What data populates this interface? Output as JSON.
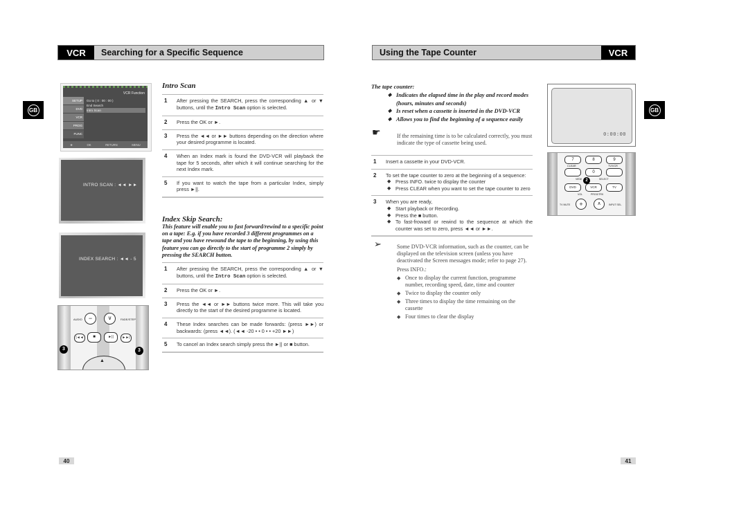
{
  "left_page": {
    "section_tag": "VCR",
    "title": "Searching for a Specific Sequence",
    "language_badge": "GB",
    "page_number": "40",
    "menu_screen": {
      "header": "VCR Function",
      "tabs": [
        "SETUP",
        "DVD",
        "VCR",
        "PROG",
        "FUNC"
      ],
      "items": [
        "Go to ( 0 : 00 : 00 )",
        "End Search",
        "Intro Scan"
      ],
      "selected_item": "Intro Scan",
      "footer": [
        "OK",
        "RETURN",
        "MENU"
      ]
    },
    "intro_screen_text": "INTRO SCAN  :   ◄◄   ►►",
    "index_screen_text": "INDEX SEARCH :  ◄◄  - 5",
    "remote": {
      "labels": [
        "AUDIO",
        "FADE/STEP"
      ],
      "callout": "3"
    },
    "intro_scan": {
      "heading": "Intro Scan",
      "steps": [
        {
          "n": "1",
          "pre": "After pressing the SEARCH, press the corresponding ▲ or ▼ buttons, until the ",
          "code": "Intro Scan",
          "post": " option is selected."
        },
        {
          "n": "2",
          "text": "Press the OK or ►."
        },
        {
          "n": "3",
          "text": "Press the ◄◄ or ►► buttons depending on the direction where your desired programme is located."
        },
        {
          "n": "4",
          "text": "When an Index mark is found the DVD-VCR will playback the tape for 5 seconds, after which it will continue searching for the next Index mark."
        },
        {
          "n": "5",
          "text": "If you want to watch the tape from a particular Index, simply press ►||."
        }
      ]
    },
    "index_skip": {
      "heading": "Index Skip Search:",
      "intro": "This feature will enable you to fast forward/rewind to a specific point on a tape: E.g. if you have recorded 3 different programmes on a tape and you have rewound the tape to the beginning, by using this feature you can go directly to the start of programme 2 simply by pressing the SEARCH button.",
      "steps": [
        {
          "n": "1",
          "pre": "After pressing the SEARCH, press the corresponding ▲ or ▼ buttons, until the ",
          "code": "Intro Scan",
          "post": " option is selected."
        },
        {
          "n": "2",
          "text": "Press the OK or ►."
        },
        {
          "n": "3",
          "text": "Press the ◄◄ or ►► buttons twice more. This will take you directly to the start of the desired programme is located."
        },
        {
          "n": "4",
          "text": "These Index searches can be made forwards: (press ►►) or backwards: (press ◄◄). (◄◄ -20 • • 0 • • +20 ►►)"
        },
        {
          "n": "5",
          "text": "To cancel an Index search simply press the ►|| or ■ button."
        }
      ]
    }
  },
  "right_page": {
    "section_tag": "VCR",
    "title": "Using the Tape Counter",
    "language_badge": "GB",
    "page_number": "41",
    "counter_screen_value": "0:00:00",
    "intro_heading": "The tape counter:",
    "intro_bullets": [
      "Indicates the elapsed time in the play and record modes (hours, minutes and seconds)",
      "Is reset when a cassette is inserted in the DVD-VCR",
      "Allows you to find the beginning of a sequence easily"
    ],
    "hand_note": "If the remaining time is to be calculated correctly, you must indicate the type of cassette being used.",
    "steps": [
      {
        "n": "1",
        "text": "Insert a cassette in your DVD-VCR.",
        "bullets": []
      },
      {
        "n": "2",
        "text": "To set the tape counter to zero at the beginning of a sequence:",
        "bullets": [
          "Press INFO. twice to display the counter",
          "Press CLEAR when you want to set the tape counter to zero"
        ]
      },
      {
        "n": "3",
        "text": "When you are ready,",
        "bullets": [
          "Start playback or Recording.",
          "Press the ■ button.",
          "To fast-froward or rewind to the sequence at which the counter was set to zero, press ◄◄ or ►►."
        ]
      }
    ],
    "arrow_note": "Some DVD-VCR information, such as the counter, can be displayed on the television screen (unless you have deactivated the Screen messages mode; refer to page 27).",
    "press_info_label": "Press INFO.:",
    "press_info_bullets": [
      "Once to display the current function, programme number, recording speed, date, time and counter",
      "Twice to display the counter only",
      "Three times to display the time remaining on the cassette",
      "Four times to clear the display"
    ],
    "remote": {
      "keys": [
        "7",
        "8",
        "9",
        "0"
      ],
      "labels": [
        "CLEAR",
        "TV/VCR",
        "VIEW",
        "SELECT",
        "DVD",
        "VCR",
        "TV",
        "VOL",
        "PROG/TRK",
        "TV MUTE",
        "INPUT SEL."
      ],
      "callout": "2"
    }
  }
}
